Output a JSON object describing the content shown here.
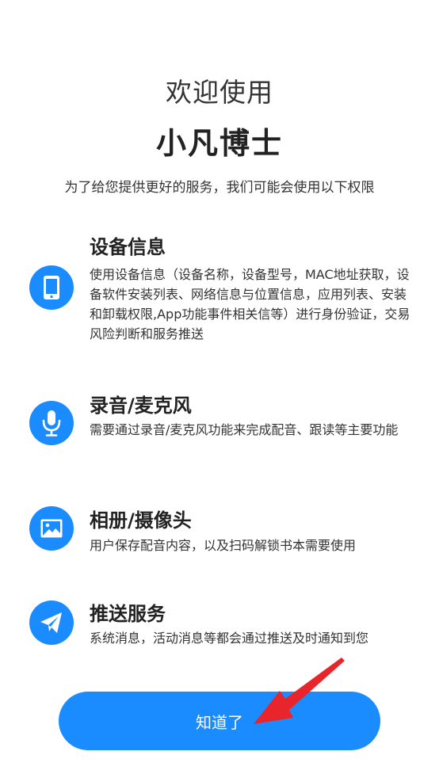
{
  "header": {
    "welcome": "欢迎使用",
    "app_name": "小凡博士",
    "intro": "为了给您提供更好的服务，我们可能会使用以下权限"
  },
  "permissions": [
    {
      "icon": "phone-icon",
      "title": "设备信息",
      "desc": "使用设备信息（设备名称，设备型号，MAC地址获取，设备软件安装列表、网络信息与位置信息，应用列表、安装和卸载权限,App功能事件相关信等）进行身份验证，交易风险判断和服务推送"
    },
    {
      "icon": "microphone-icon",
      "title": "录音/麦克风",
      "desc": "需要通过录音/麦克风功能来完成配音、跟读等主要功能"
    },
    {
      "icon": "image-icon",
      "title": "相册/摄像头",
      "desc": "用户保存配音内容，以及扫码解锁书本需要使用"
    },
    {
      "icon": "paper-plane-icon",
      "title": "推送服务",
      "desc": "系统消息，活动消息等都会通过推送及时通知到您"
    }
  ],
  "footer": {
    "ok_label": "知道了"
  },
  "colors": {
    "accent": "#1a8cff",
    "annotation_arrow": "#e8252a"
  }
}
